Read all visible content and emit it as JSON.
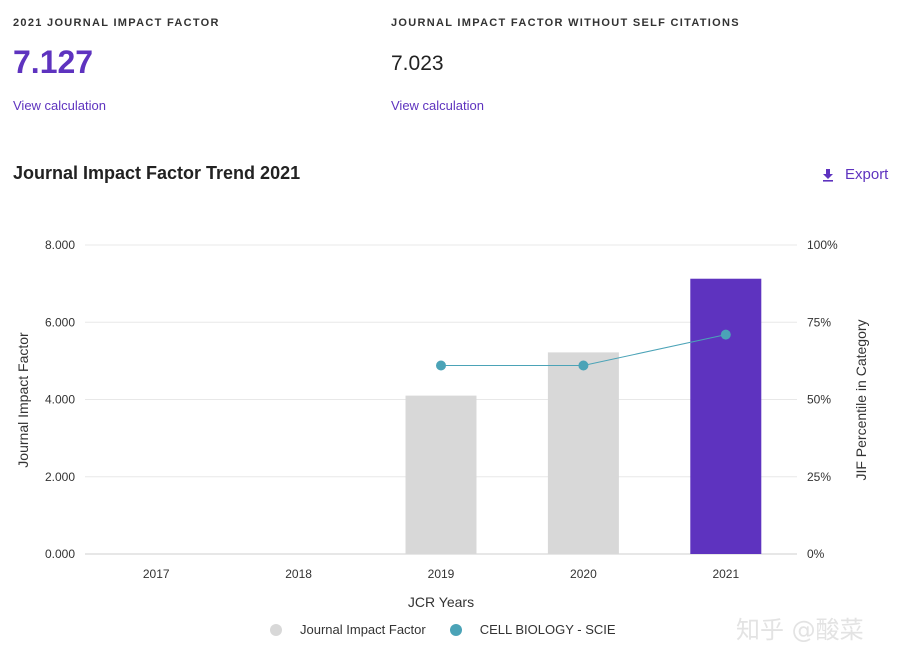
{
  "metrics": {
    "jif": {
      "label": "2021 JOURNAL IMPACT FACTOR",
      "value": "7.127",
      "link": "View calculation"
    },
    "jif_no_self": {
      "label": "JOURNAL IMPACT FACTOR WITHOUT SELF CITATIONS",
      "value": "7.023",
      "link": "View calculation"
    }
  },
  "section": {
    "title": "Journal Impact Factor Trend 2021",
    "export_label": "Export"
  },
  "colors": {
    "accent": "#5e33bf",
    "bar_default": "#d8d8d8",
    "bar_current": "#5e33bf",
    "line": "#4ba3b7"
  },
  "chart_data": {
    "type": "bar",
    "categories": [
      "2017",
      "2018",
      "2019",
      "2020",
      "2021"
    ],
    "xlabel": "JCR Years",
    "ylabel": "Journal Impact Factor",
    "y2label": "JIF Percentile in Category",
    "ylim": [
      0,
      8
    ],
    "y2lim": [
      0,
      100
    ],
    "y_ticks": [
      "0.000",
      "2.000",
      "4.000",
      "6.000",
      "8.000"
    ],
    "y2_ticks": [
      "0%",
      "25%",
      "50%",
      "75%",
      "100%"
    ],
    "grid": true,
    "legend_position": "bottom",
    "series": [
      {
        "name": "Journal Impact Factor",
        "type": "bar",
        "axis": "left",
        "values": [
          null,
          null,
          4.1,
          5.22,
          7.127
        ]
      },
      {
        "name": "CELL BIOLOGY - SCIE",
        "type": "line",
        "axis": "right",
        "values": [
          null,
          null,
          61,
          61,
          71
        ]
      }
    ]
  },
  "watermark": "知乎 @酸菜"
}
